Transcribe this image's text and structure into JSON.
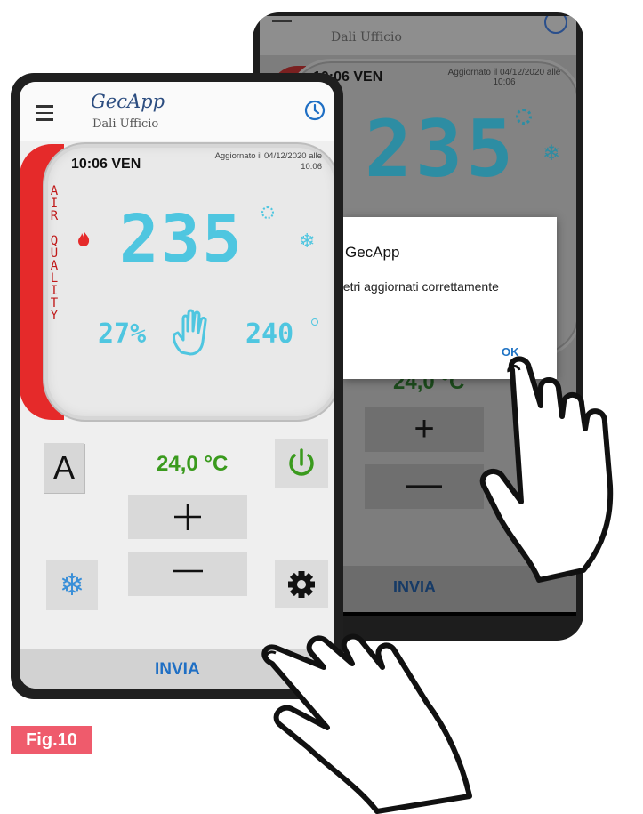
{
  "figure_label": "Fig.10",
  "front": {
    "app_title": "GecApp",
    "app_subtitle": "Dali Ufficio",
    "time": "10:06 VEN",
    "updated": "Aggiornato il 04/12/2020 alle 10:06",
    "air_quality": [
      "A",
      "I",
      "R",
      "",
      "Q",
      "U",
      "A",
      "L",
      "I",
      "T",
      "Y"
    ],
    "temperature": "235",
    "humidity": "27%",
    "setpoint_small": "240",
    "mode_label": "A",
    "setpoint": "24,0 °C",
    "plus_label": "+",
    "minus_label": "—",
    "snow_label": "❄",
    "invia_label": "INVIA"
  },
  "back": {
    "app_subtitle": "Dali Ufficio",
    "time": "10:06 VEN",
    "updated": "Aggiornato il 04/12/2020 alle 10:06",
    "temperature": "235",
    "setpoint": "24,0 °C",
    "invia_label": "INVIA",
    "dialog": {
      "title": "GecApp",
      "message": "netri aggiornati correttamente",
      "ok": "OK"
    },
    "nav": [
      "□",
      "○",
      "◁"
    ]
  },
  "colors": {
    "accent_blue": "#1f6fc4",
    "display_cyan": "#4fc6e0",
    "setpoint_green": "#3a9a1d",
    "air_red": "#e52a2a",
    "fig_pink": "#ef5b6c"
  }
}
